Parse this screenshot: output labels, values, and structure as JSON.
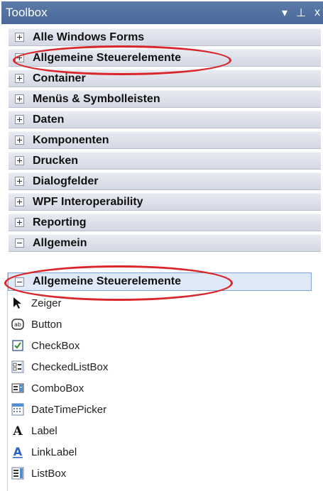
{
  "toolbox": {
    "title": "Toolbox",
    "pin_glyph": "▾",
    "dock_glyph": "⊥",
    "close_glyph": "x"
  },
  "categories": [
    {
      "label": "Alle Windows Forms",
      "expanded": false
    },
    {
      "label": "Allgemeine Steuerelemente",
      "expanded": false
    },
    {
      "label": "Container",
      "expanded": false
    },
    {
      "label": "Menüs & Symbolleisten",
      "expanded": false
    },
    {
      "label": "Daten",
      "expanded": false
    },
    {
      "label": "Komponenten",
      "expanded": false
    },
    {
      "label": "Drucken",
      "expanded": false
    },
    {
      "label": "Dialogfelder",
      "expanded": false
    },
    {
      "label": "WPF Interoperability",
      "expanded": false
    },
    {
      "label": "Reporting",
      "expanded": false
    },
    {
      "label": "Allgemein",
      "expanded": true
    }
  ],
  "expanded_category": {
    "label": "Allgemeine Steuerelemente",
    "tools": [
      {
        "label": "Zeiger",
        "icon": "pointer-icon"
      },
      {
        "label": "Button",
        "icon": "button-icon"
      },
      {
        "label": "CheckBox",
        "icon": "checkbox-icon"
      },
      {
        "label": "CheckedListBox",
        "icon": "checkedlistbox-icon"
      },
      {
        "label": "ComboBox",
        "icon": "combobox-icon"
      },
      {
        "label": "DateTimePicker",
        "icon": "datetimepicker-icon"
      },
      {
        "label": "Label",
        "icon": "label-icon"
      },
      {
        "label": "LinkLabel",
        "icon": "linklabel-icon"
      },
      {
        "label": "ListBox",
        "icon": "listbox-icon"
      }
    ]
  },
  "colors": {
    "titlebar": "#4a6899",
    "highlight_ellipse": "#d9262b",
    "selected_row": "#dfe9f7"
  }
}
